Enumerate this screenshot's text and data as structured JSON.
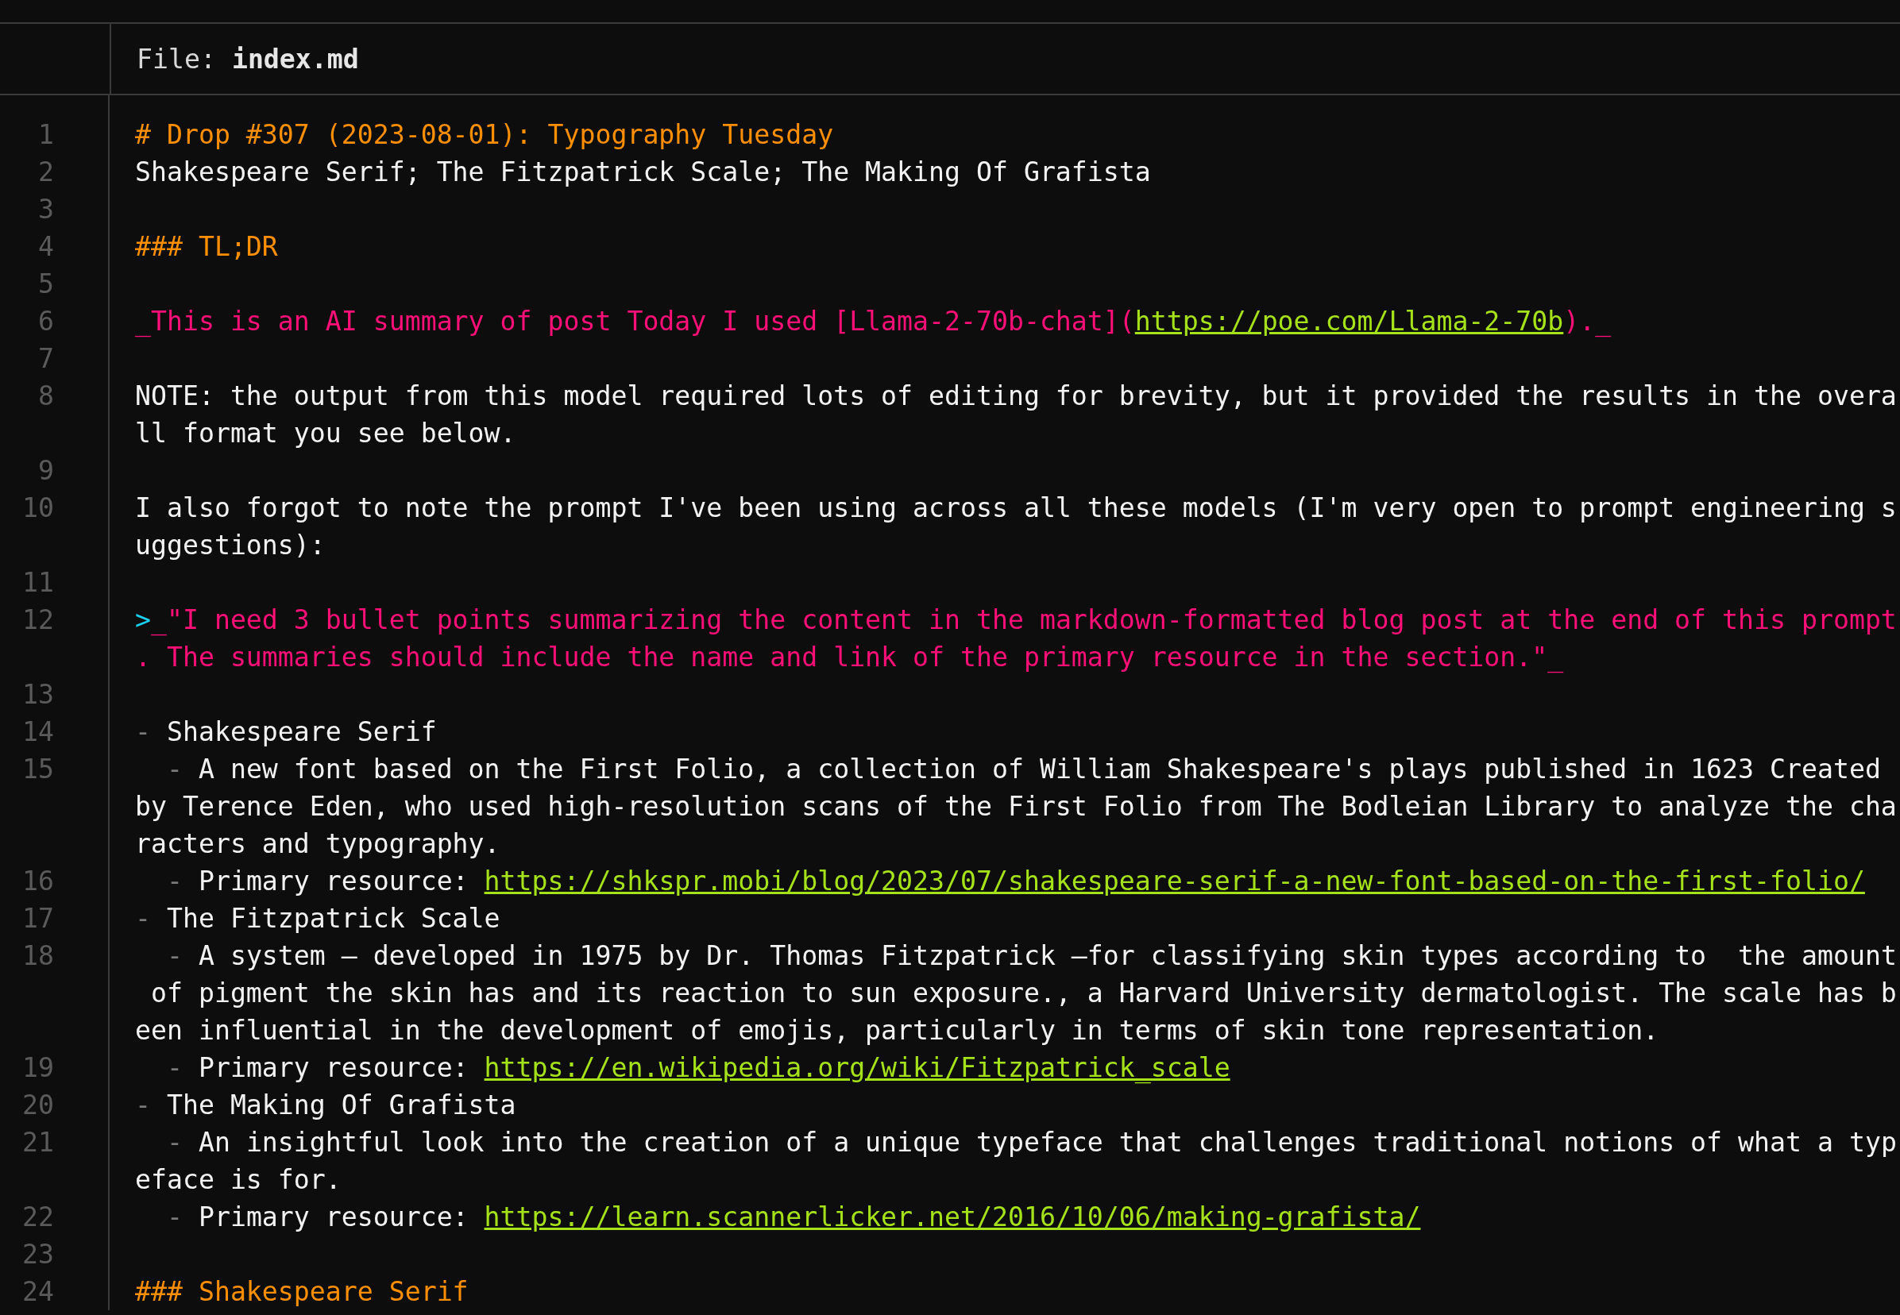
{
  "header": {
    "label": "File:",
    "filename": "index.md"
  },
  "lines": [
    {
      "number": "1",
      "rows": [
        [
          {
            "kind": "heading",
            "text": "# Drop #307 (2023-08-01): Typography Tuesday"
          }
        ]
      ]
    },
    {
      "number": "2",
      "rows": [
        [
          {
            "kind": "text",
            "text": "Shakespeare Serif; The Fitzpatrick Scale; The Making Of Grafista"
          }
        ]
      ]
    },
    {
      "number": "3"
    },
    {
      "number": "4",
      "rows": [
        [
          {
            "kind": "heading",
            "text": "### TL;DR"
          }
        ]
      ]
    },
    {
      "number": "5"
    },
    {
      "number": "6",
      "rows": [
        [
          {
            "kind": "emphasis",
            "text": "_This is an AI summary of post Today I used [Llama-2-70b-chat]("
          },
          {
            "kind": "link",
            "text": "https://poe.com/Llama-2-70b"
          },
          {
            "kind": "emphasis",
            "text": ")._"
          }
        ]
      ]
    },
    {
      "number": "7"
    },
    {
      "number": "8",
      "rows": [
        [
          {
            "kind": "text",
            "text": "NOTE: the output from this model required lots of editing for brevity, but it provided the results in the overa"
          }
        ],
        [
          {
            "kind": "text",
            "text": "ll format you see below."
          }
        ]
      ]
    },
    {
      "number": "9"
    },
    {
      "number": "10",
      "rows": [
        [
          {
            "kind": "text",
            "text": "I also forgot to note the prompt I've been using across all these models (I'm very open to prompt engineering s"
          }
        ],
        [
          {
            "kind": "text",
            "text": "uggestions):"
          }
        ]
      ]
    },
    {
      "number": "11"
    },
    {
      "number": "12",
      "rows": [
        [
          {
            "kind": "quote",
            "text": ">"
          },
          {
            "kind": "emphasis",
            "text": "_\"I need 3 bullet points summarizing the content in the markdown-formatted blog post at the end of this prompt"
          }
        ],
        [
          {
            "kind": "emphasis",
            "text": ". The summaries should include the name and link of the primary resource in the section.\"_"
          }
        ]
      ]
    },
    {
      "number": "13"
    },
    {
      "number": "14",
      "rows": [
        [
          {
            "kind": "marker",
            "text": "- "
          },
          {
            "kind": "text",
            "text": "Shakespeare Serif"
          }
        ]
      ]
    },
    {
      "number": "15",
      "rows": [
        [
          {
            "kind": "marker",
            "text": "  - "
          },
          {
            "kind": "text",
            "text": "A new font based on the First Folio, a collection of William Shakespeare's plays published in 1623 Created"
          }
        ],
        [
          {
            "kind": "text",
            "text": "by Terence Eden, who used high-resolution scans of the First Folio from The Bodleian Library to analyze the cha"
          }
        ],
        [
          {
            "kind": "text",
            "text": "racters and typography."
          }
        ]
      ]
    },
    {
      "number": "16",
      "rows": [
        [
          {
            "kind": "marker",
            "text": "  - "
          },
          {
            "kind": "text",
            "text": "Primary resource: "
          },
          {
            "kind": "link",
            "text": "https://shkspr.mobi/blog/2023/07/shakespeare-serif-a-new-font-based-on-the-first-folio/"
          }
        ]
      ]
    },
    {
      "number": "17",
      "rows": [
        [
          {
            "kind": "marker",
            "text": "- "
          },
          {
            "kind": "text",
            "text": "The Fitzpatrick Scale"
          }
        ]
      ]
    },
    {
      "number": "18",
      "rows": [
        [
          {
            "kind": "marker",
            "text": "  - "
          },
          {
            "kind": "text",
            "text": "A system — developed in 1975 by Dr. Thomas Fitzpatrick —for classifying skin types according to  the amount"
          }
        ],
        [
          {
            "kind": "text",
            "text": " of pigment the skin has and its reaction to sun exposure., a Harvard University dermatologist. The scale has b"
          }
        ],
        [
          {
            "kind": "text",
            "text": "een influential in the development of emojis, particularly in terms of skin tone representation."
          }
        ]
      ]
    },
    {
      "number": "19",
      "rows": [
        [
          {
            "kind": "marker",
            "text": "  - "
          },
          {
            "kind": "text",
            "text": "Primary resource: "
          },
          {
            "kind": "link",
            "text": "https://en.wikipedia.org/wiki/Fitzpatrick_scale"
          }
        ]
      ]
    },
    {
      "number": "20",
      "rows": [
        [
          {
            "kind": "marker",
            "text": "- "
          },
          {
            "kind": "text",
            "text": "The Making Of Grafista"
          }
        ]
      ]
    },
    {
      "number": "21",
      "rows": [
        [
          {
            "kind": "marker",
            "text": "  - "
          },
          {
            "kind": "text",
            "text": "An insightful look into the creation of a unique typeface that challenges traditional notions of what a typ"
          }
        ],
        [
          {
            "kind": "text",
            "text": "eface is for."
          }
        ]
      ]
    },
    {
      "number": "22",
      "rows": [
        [
          {
            "kind": "marker",
            "text": "  - "
          },
          {
            "kind": "text",
            "text": "Primary resource: "
          },
          {
            "kind": "link",
            "text": "https://learn.scannerlicker.net/2016/10/06/making-grafista/"
          }
        ]
      ]
    },
    {
      "number": "23"
    },
    {
      "number": "24",
      "rows": [
        [
          {
            "kind": "heading",
            "text": "### Shakespeare Serif"
          }
        ]
      ]
    }
  ]
}
